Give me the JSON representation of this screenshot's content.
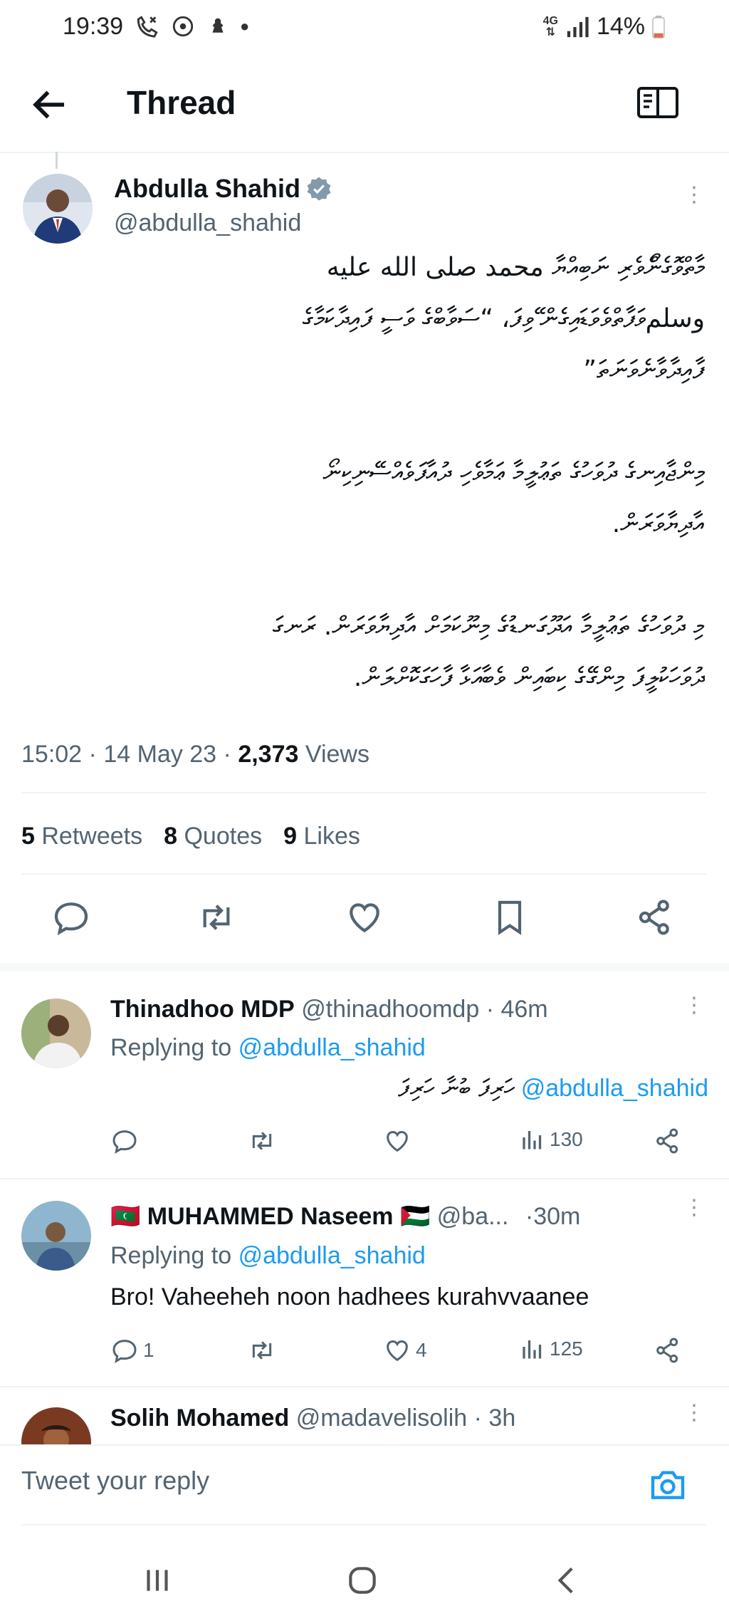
{
  "status_bar": {
    "time": "19:39",
    "network": "4G",
    "battery": "14%"
  },
  "header": {
    "title": "Thread"
  },
  "main_tweet": {
    "author_name": "Abdulla Shahid",
    "author_handle": "@abdulla_shahid",
    "body_lines": [
      "މާތްވޮގެންޯވެރި ނަބިއްޔާ محمد صلى الله عليه",
      "وسلمވަފާތްވެވަޑައިގެން ޭވިފަ، “ސަވާބްގެ ވަސީ ފައިދާކަމާގެ",
      "ފާއިދާވާނެވަނަތަ”",
      "",
      "މިންޖާއިނގެ ދުވަހުގެ ތަޢުލީމާ ޢަމާވެހި ދުއާފަވެއްސޭނިކިނޯ",
      "އާދިޔާވަރަން.",
      "",
      "މި ދުވަހުގެ ތަޢުލީމާ އަދޫގަނޑުގެ މިނޫކަމަށް އާދިޔާވަރަން. ރަނގަ",
      "ދުވަހަކުލީފަ މިންގޭގެ ކިބައިން ވެބާއަޅާ ފާހަގަކޮށްލަން."
    ],
    "time": "15:02",
    "date": "14 May 23",
    "views_count": "2,373",
    "views_label": "Views",
    "retweets_count": "5",
    "retweets_label": "Retweets",
    "quotes_count": "8",
    "quotes_label": "Quotes",
    "likes_count": "9",
    "likes_label": "Likes"
  },
  "replies": [
    {
      "name": "Thinadhoo MDP",
      "handle": "@thinadhoomdp",
      "time": "· 46m",
      "replying_label": "Replying to",
      "replying_to": "@abdulla_shahid",
      "mention": "@abdulla_shahid",
      "text": "ހަރިފަ ބުނާ ހަރިފަ",
      "replies": "",
      "retweets": "",
      "likes": "",
      "views": "130"
    },
    {
      "name": "MUHAMMED Naseem",
      "flag_left": "🇲🇻",
      "flag_right": "🇵🇸",
      "handle": "@ba...",
      "time": "·30m",
      "replying_label": "Replying to",
      "replying_to": "@abdulla_shahid",
      "text": "Bro! Vaheeheh noon hadhees kurahvvaanee",
      "replies": "1",
      "retweets": "",
      "likes": "4",
      "views": "125"
    },
    {
      "name": "Solih Mohamed",
      "handle": "@madavelisolih",
      "time": "· 3h"
    }
  ],
  "reply_bar": {
    "placeholder": "Tweet your reply"
  },
  "icons": {
    "back": "arrow-left-icon",
    "reader": "book-icon",
    "verified": "verified-badge-icon",
    "reply": "reply-icon",
    "retweet": "retweet-icon",
    "like": "heart-icon",
    "bookmark": "bookmark-icon",
    "share": "share-icon",
    "views": "views-chart-icon",
    "camera": "camera-icon"
  },
  "colors": {
    "link": "#1d9bf0",
    "muted": "#536471",
    "text": "#0f1419"
  }
}
